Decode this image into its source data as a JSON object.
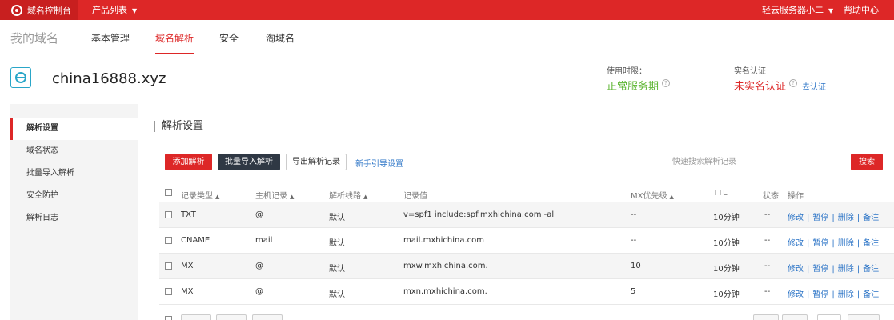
{
  "topbar": {
    "brand": "域名控制台",
    "products": "产品列表",
    "user": "轻云服务器小二",
    "help": "帮助中心"
  },
  "nav": {
    "mydomain": "我的域名",
    "tabs": [
      "基本管理",
      "域名解析",
      "安全",
      "淘域名"
    ],
    "active_tab": "域名解析"
  },
  "domain": {
    "name": "china16888.xyz",
    "period_label": "使用时限：",
    "period_value": "正常服务期",
    "verify_label": "实名认证",
    "verify_value": "未实名认证",
    "verify_link": "去认证"
  },
  "sidebar": {
    "items": [
      "解析设置",
      "域名状态",
      "批量导入解析",
      "安全防护",
      "解析日志"
    ],
    "active": "解析设置"
  },
  "main": {
    "title": "解析设置",
    "add_button": "添加解析",
    "import_button": "批量导入解析",
    "export_button": "导出解析记录",
    "guide_link": "新手引导设置",
    "search_placeholder": "快速搜索解析记录",
    "search_button": "搜索"
  },
  "table": {
    "headers": {
      "type": "记录类型",
      "host": "主机记录",
      "line": "解析线路",
      "value": "记录值",
      "mx": "MX优先级",
      "ttl": "TTL",
      "status": "状态",
      "ops": "操作"
    },
    "rows": [
      {
        "type": "TXT",
        "host": "@",
        "line": "默认",
        "value": "v=spf1 include:spf.mxhichina.com -all",
        "mx": "--",
        "ttl": "10分钟",
        "status": "--"
      },
      {
        "type": "CNAME",
        "host": "mail",
        "line": "默认",
        "value": "mail.mxhichina.com",
        "mx": "--",
        "ttl": "10分钟",
        "status": "--"
      },
      {
        "type": "MX",
        "host": "@",
        "line": "默认",
        "value": "mxw.mxhichina.com.",
        "mx": "10",
        "ttl": "10分钟",
        "status": "--"
      },
      {
        "type": "MX",
        "host": "@",
        "line": "默认",
        "value": "mxn.mxhichina.com.",
        "mx": "5",
        "ttl": "10分钟",
        "status": "--"
      }
    ],
    "ops": {
      "edit": "修改",
      "pause": "暂停",
      "delete": "删除",
      "note": "备注"
    }
  },
  "colors": {
    "brand_red": "#dd2727",
    "dark_button": "#2f3844",
    "link_blue": "#2a73c6",
    "status_green": "#5cb531"
  },
  "icons": [
    "logo-icon",
    "chevron-down-icon",
    "domain-globe-icon",
    "help-question-icon",
    "sort-up-icon",
    "checkbox-icon"
  ]
}
